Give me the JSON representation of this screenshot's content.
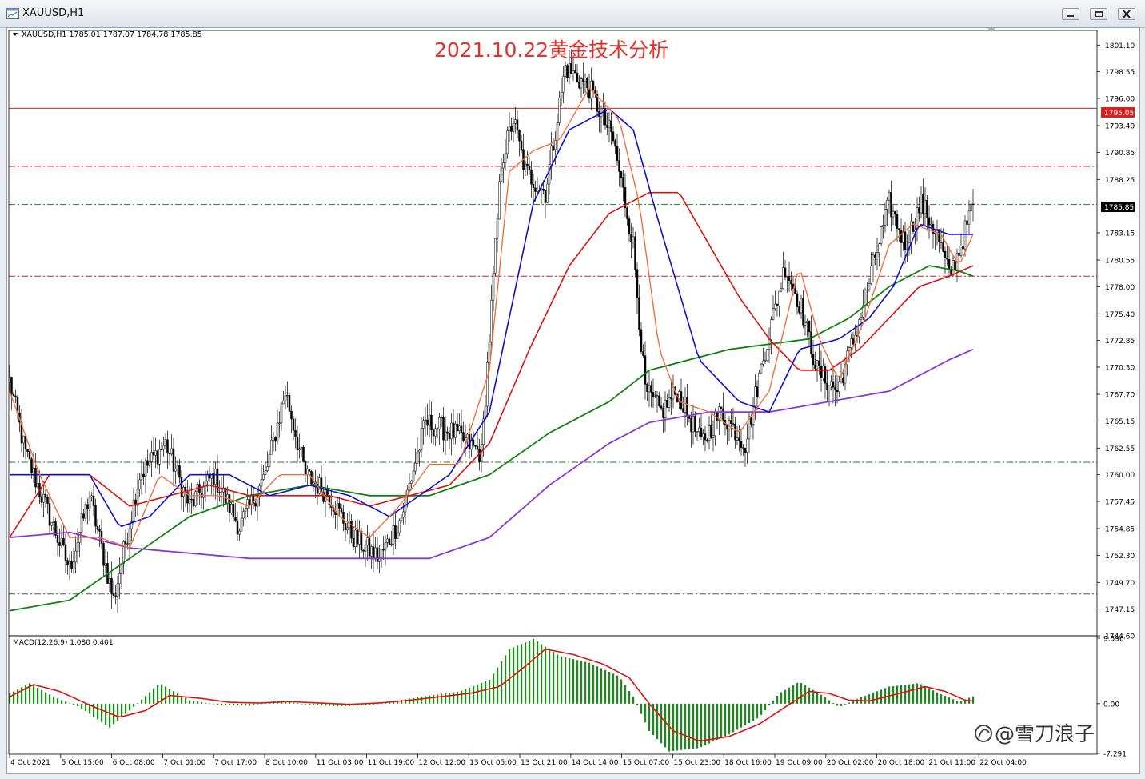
{
  "window": {
    "title": "XAUUSD,H1"
  },
  "chart_header": {
    "symbol_info": "XAUUSD,H1  1785.01 1787.07 1784.78 1785.85"
  },
  "overlay_title": "2021.10.22黄金技术分析",
  "price_axis": {
    "ticks": [
      "1801.10",
      "1798.55",
      "1796.00",
      "1793.40",
      "1790.85",
      "1788.25",
      "1785.70",
      "1783.15",
      "1780.55",
      "1778.00",
      "1775.40",
      "1772.85",
      "1770.30",
      "1767.70",
      "1765.15",
      "1762.55",
      "1760.00",
      "1757.45",
      "1754.85",
      "1752.30",
      "1749.70",
      "1747.15",
      "1744.60"
    ],
    "current_price_tag": "1785.85",
    "resistance_tag": "1795.05"
  },
  "macd": {
    "label": "MACD(12,26,9) 1.080 0.401",
    "axis_ticks": [
      "9.596",
      "0.00",
      "-7.291"
    ]
  },
  "time_axis": {
    "labels": [
      "4 Oct 2021",
      "5 Oct 15:00",
      "6 Oct 08:00",
      "7 Oct 01:00",
      "7 Oct 17:00",
      "8 Oct 10:00",
      "11 Oct 03:00",
      "11 Oct 19:00",
      "12 Oct 12:00",
      "13 Oct 05:00",
      "13 Oct 21:00",
      "14 Oct 14:00",
      "15 Oct 07:00",
      "15 Oct 23:00",
      "18 Oct 16:00",
      "19 Oct 09:00",
      "20 Oct 02:00",
      "20 Oct 18:00",
      "21 Oct 11:00",
      "22 Oct 04:00"
    ]
  },
  "watermark": "@雪刀浪子",
  "colors": {
    "bullish": "#000000",
    "bearish": "#000000",
    "ma_fast": "#f07040",
    "ma_blue": "#1010d0",
    "ma_red": "#e01010",
    "ma_green": "#108010",
    "ma_purple": "#8a35d8",
    "level_line": "#e02020",
    "support_line": "#208020",
    "macd_hist": "#1a8a1a",
    "macd_signal": "#e01010",
    "title_red": "#e8302a"
  },
  "chart_data": {
    "type": "candlestick",
    "price_range": [
      1744.6,
      1802.5
    ],
    "lines": [
      {
        "price": 1795.05,
        "style": "solid",
        "color": "red"
      },
      {
        "price": 1789.5,
        "style": "dashdot",
        "color": "red"
      },
      {
        "price": 1785.85,
        "style": "dashdot",
        "color": "green"
      },
      {
        "price": 1779.0,
        "style": "dashdot",
        "color": "red"
      },
      {
        "price": 1761.2,
        "style": "dashdot",
        "color": "green"
      },
      {
        "price": 1748.6,
        "style": "dashdot",
        "color": "green"
      }
    ],
    "close_keypoints": [
      [
        0,
        1769
      ],
      [
        8,
        1762
      ],
      [
        18,
        1757
      ],
      [
        30,
        1751
      ],
      [
        40,
        1758
      ],
      [
        52,
        1748
      ],
      [
        65,
        1760
      ],
      [
        78,
        1763
      ],
      [
        90,
        1757
      ],
      [
        102,
        1760
      ],
      [
        115,
        1755
      ],
      [
        128,
        1760
      ],
      [
        138,
        1768
      ],
      [
        148,
        1760
      ],
      [
        160,
        1758
      ],
      [
        172,
        1754
      ],
      [
        185,
        1752
      ],
      [
        196,
        1756
      ],
      [
        208,
        1765
      ],
      [
        222,
        1764
      ],
      [
        236,
        1762
      ],
      [
        246,
        1790
      ],
      [
        252,
        1794
      ],
      [
        258,
        1789
      ],
      [
        268,
        1787
      ],
      [
        278,
        1799
      ],
      [
        290,
        1797
      ],
      [
        302,
        1792
      ],
      [
        312,
        1782
      ],
      [
        318,
        1768
      ],
      [
        326,
        1766
      ],
      [
        334,
        1768
      ],
      [
        346,
        1763
      ],
      [
        356,
        1766
      ],
      [
        368,
        1763
      ],
      [
        378,
        1772
      ],
      [
        388,
        1780
      ],
      [
        396,
        1776
      ],
      [
        404,
        1770
      ],
      [
        414,
        1768
      ],
      [
        424,
        1774
      ],
      [
        432,
        1780
      ],
      [
        440,
        1786
      ],
      [
        448,
        1782
      ],
      [
        456,
        1786
      ],
      [
        464,
        1783
      ],
      [
        470,
        1779
      ],
      [
        476,
        1782
      ],
      [
        482,
        1785.85
      ]
    ],
    "ma_fast_keypoints": [
      [
        0,
        1768
      ],
      [
        15,
        1760
      ],
      [
        30,
        1754
      ],
      [
        45,
        1754
      ],
      [
        60,
        1753
      ],
      [
        75,
        1760
      ],
      [
        90,
        1758
      ],
      [
        105,
        1758
      ],
      [
        120,
        1757
      ],
      [
        135,
        1760
      ],
      [
        150,
        1760
      ],
      [
        165,
        1756
      ],
      [
        180,
        1754
      ],
      [
        195,
        1757
      ],
      [
        210,
        1761
      ],
      [
        225,
        1761
      ],
      [
        240,
        1770
      ],
      [
        250,
        1789
      ],
      [
        262,
        1791
      ],
      [
        275,
        1792
      ],
      [
        290,
        1797
      ],
      [
        305,
        1794
      ],
      [
        315,
        1786
      ],
      [
        325,
        1772
      ],
      [
        335,
        1767
      ],
      [
        350,
        1766
      ],
      [
        365,
        1764
      ],
      [
        380,
        1768
      ],
      [
        395,
        1780
      ],
      [
        405,
        1773
      ],
      [
        415,
        1769
      ],
      [
        428,
        1775
      ],
      [
        440,
        1782
      ],
      [
        452,
        1784
      ],
      [
        466,
        1783
      ],
      [
        475,
        1780
      ],
      [
        482,
        1783
      ]
    ],
    "ma_blue_keypoints": [
      [
        0,
        1760
      ],
      [
        20,
        1760
      ],
      [
        40,
        1760
      ],
      [
        55,
        1755
      ],
      [
        70,
        1756
      ],
      [
        90,
        1760
      ],
      [
        110,
        1760
      ],
      [
        130,
        1758
      ],
      [
        150,
        1759
      ],
      [
        170,
        1758
      ],
      [
        190,
        1756
      ],
      [
        205,
        1758
      ],
      [
        220,
        1760
      ],
      [
        240,
        1766
      ],
      [
        262,
        1786
      ],
      [
        280,
        1793
      ],
      [
        300,
        1795
      ],
      [
        312,
        1793
      ],
      [
        325,
        1784
      ],
      [
        345,
        1771
      ],
      [
        365,
        1767
      ],
      [
        380,
        1766
      ],
      [
        395,
        1772
      ],
      [
        415,
        1773
      ],
      [
        430,
        1775
      ],
      [
        442,
        1778
      ],
      [
        455,
        1784
      ],
      [
        470,
        1783
      ],
      [
        482,
        1783
      ]
    ],
    "ma_red_keypoints": [
      [
        0,
        1754
      ],
      [
        20,
        1760
      ],
      [
        40,
        1760
      ],
      [
        60,
        1757
      ],
      [
        80,
        1758
      ],
      [
        100,
        1759
      ],
      [
        120,
        1758
      ],
      [
        140,
        1758
      ],
      [
        160,
        1758
      ],
      [
        180,
        1757
      ],
      [
        200,
        1758
      ],
      [
        220,
        1759
      ],
      [
        240,
        1763
      ],
      [
        260,
        1772
      ],
      [
        280,
        1780
      ],
      [
        300,
        1785
      ],
      [
        320,
        1787
      ],
      [
        335,
        1787
      ],
      [
        350,
        1782
      ],
      [
        365,
        1777
      ],
      [
        380,
        1773
      ],
      [
        395,
        1770
      ],
      [
        410,
        1770
      ],
      [
        425,
        1772
      ],
      [
        440,
        1775
      ],
      [
        455,
        1778
      ],
      [
        470,
        1779
      ],
      [
        482,
        1780
      ]
    ],
    "ma_green_keypoints": [
      [
        0,
        1747
      ],
      [
        30,
        1748
      ],
      [
        60,
        1752
      ],
      [
        90,
        1756
      ],
      [
        120,
        1758
      ],
      [
        150,
        1759
      ],
      [
        180,
        1758
      ],
      [
        210,
        1758
      ],
      [
        240,
        1760
      ],
      [
        270,
        1764
      ],
      [
        300,
        1767
      ],
      [
        320,
        1770
      ],
      [
        340,
        1771
      ],
      [
        360,
        1772
      ],
      [
        380,
        1772.5
      ],
      [
        400,
        1773
      ],
      [
        420,
        1775
      ],
      [
        440,
        1778
      ],
      [
        460,
        1780
      ],
      [
        475,
        1779.5
      ],
      [
        482,
        1779
      ]
    ],
    "ma_purple_keypoints": [
      [
        0,
        1754
      ],
      [
        30,
        1754.5
      ],
      [
        60,
        1753
      ],
      [
        90,
        1752.5
      ],
      [
        120,
        1752
      ],
      [
        150,
        1752
      ],
      [
        180,
        1752
      ],
      [
        210,
        1752
      ],
      [
        240,
        1754
      ],
      [
        270,
        1759
      ],
      [
        300,
        1763
      ],
      [
        320,
        1765
      ],
      [
        350,
        1766
      ],
      [
        380,
        1766
      ],
      [
        410,
        1767
      ],
      [
        440,
        1768
      ],
      [
        470,
        1771
      ],
      [
        482,
        1772
      ]
    ],
    "macd_hist_keypoints": [
      [
        0,
        1.5
      ],
      [
        10,
        3.0
      ],
      [
        22,
        1.0
      ],
      [
        35,
        -0.5
      ],
      [
        50,
        -3.5
      ],
      [
        60,
        -1.0
      ],
      [
        75,
        3.0
      ],
      [
        90,
        0.5
      ],
      [
        105,
        -0.2
      ],
      [
        120,
        -0.3
      ],
      [
        135,
        0.5
      ],
      [
        150,
        -0.2
      ],
      [
        165,
        -0.4
      ],
      [
        180,
        -0.2
      ],
      [
        195,
        0.5
      ],
      [
        210,
        1.2
      ],
      [
        225,
        1.8
      ],
      [
        240,
        3.5
      ],
      [
        250,
        8.0
      ],
      [
        262,
        9.5
      ],
      [
        275,
        7.0
      ],
      [
        290,
        6.0
      ],
      [
        305,
        4.0
      ],
      [
        312,
        1.0
      ],
      [
        320,
        -4.0
      ],
      [
        330,
        -7.0
      ],
      [
        345,
        -6.5
      ],
      [
        360,
        -4.5
      ],
      [
        375,
        -2.0
      ],
      [
        385,
        1.5
      ],
      [
        395,
        3.2
      ],
      [
        405,
        1.5
      ],
      [
        415,
        -0.5
      ],
      [
        425,
        0.8
      ],
      [
        440,
        2.5
      ],
      [
        455,
        3.0
      ],
      [
        465,
        1.5
      ],
      [
        475,
        0.3
      ],
      [
        482,
        1.08
      ]
    ],
    "macd_signal_keypoints": [
      [
        0,
        1.0
      ],
      [
        12,
        2.8
      ],
      [
        25,
        1.8
      ],
      [
        40,
        -0.2
      ],
      [
        55,
        -2.0
      ],
      [
        68,
        -1.0
      ],
      [
        80,
        1.2
      ],
      [
        95,
        0.8
      ],
      [
        110,
        0.2
      ],
      [
        125,
        0.1
      ],
      [
        140,
        0.3
      ],
      [
        155,
        0.1
      ],
      [
        170,
        -0.1
      ],
      [
        185,
        0.1
      ],
      [
        200,
        0.5
      ],
      [
        215,
        1.0
      ],
      [
        230,
        1.5
      ],
      [
        245,
        2.5
      ],
      [
        258,
        5.5
      ],
      [
        268,
        8.0
      ],
      [
        282,
        7.2
      ],
      [
        297,
        5.8
      ],
      [
        310,
        3.8
      ],
      [
        320,
        0.0
      ],
      [
        332,
        -4.0
      ],
      [
        345,
        -5.5
      ],
      [
        360,
        -4.8
      ],
      [
        375,
        -3.0
      ],
      [
        388,
        -0.5
      ],
      [
        400,
        1.8
      ],
      [
        410,
        1.5
      ],
      [
        420,
        0.5
      ],
      [
        430,
        0.4
      ],
      [
        445,
        1.5
      ],
      [
        458,
        2.5
      ],
      [
        468,
        1.8
      ],
      [
        478,
        0.5
      ],
      [
        482,
        0.401
      ]
    ]
  }
}
